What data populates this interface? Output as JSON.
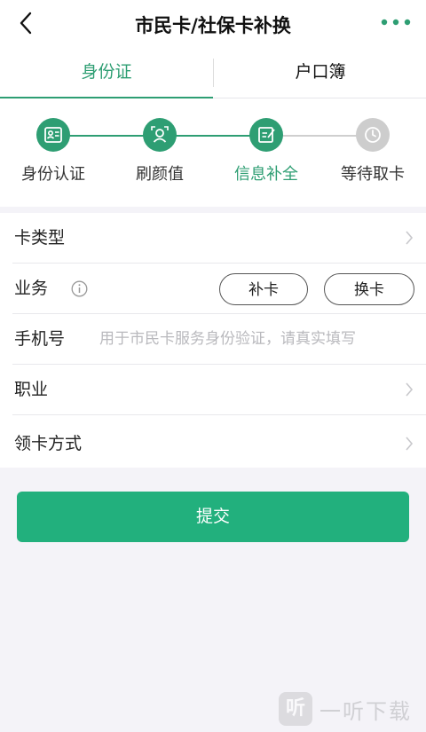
{
  "header": {
    "title": "市民卡/社保卡补换",
    "back_icon": "chevron-left-icon",
    "more_icon": "more-dots-icon"
  },
  "tabs": [
    {
      "label": "身份证",
      "active": true
    },
    {
      "label": "户口簿",
      "active": false
    }
  ],
  "steps": [
    {
      "label": "身份认证",
      "icon": "id-card-icon",
      "state": "done"
    },
    {
      "label": "刷颜值",
      "icon": "face-icon",
      "state": "done"
    },
    {
      "label": "信息补全",
      "icon": "edit-form-icon",
      "state": "active"
    },
    {
      "label": "等待取卡",
      "icon": "clock-icon",
      "state": "pending"
    }
  ],
  "form": {
    "card_type_label": "卡类型",
    "business_label": "业务",
    "business_options": [
      "补卡",
      "换卡"
    ],
    "phone_label": "手机号",
    "phone_placeholder": "用于市民卡服务身份验证，请真实填写",
    "phone_value": "",
    "job_label": "职业",
    "pickup_label": "领卡方式"
  },
  "submit_label": "提交",
  "colors": {
    "accent": "#2e9e73",
    "submit": "#22b07d",
    "pending": "#cdcdcd",
    "background": "#f4f3f8"
  },
  "watermark": {
    "logo_text": "听",
    "text": "一听下载"
  }
}
